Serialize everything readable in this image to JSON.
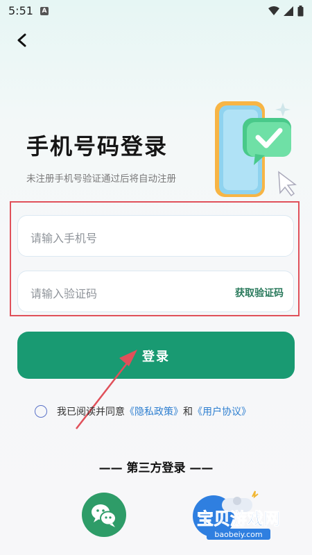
{
  "status_bar": {
    "time": "5:51",
    "app_icon": "A"
  },
  "header": {
    "back_icon": "back-chevron-icon"
  },
  "title": "手机号码登录",
  "subtitle": "未注册手机号验证通过后将自动注册",
  "phone_input": {
    "placeholder": "请输入手机号"
  },
  "code_input": {
    "placeholder": "请输入验证码",
    "get_code_label": "获取验证码"
  },
  "login_button": {
    "label": "登录"
  },
  "agreement": {
    "prefix": "我已阅读并同意",
    "privacy": "《隐私政策》",
    "and": "和",
    "user": "《用户协议》"
  },
  "third_party": {
    "title": "—— 第三方登录 ——",
    "options": [
      "wechat-icon"
    ]
  },
  "watermark": {
    "text": "宝贝游戏网",
    "url": "baobeiy.com"
  },
  "colors": {
    "primary": "#199a72",
    "link": "#2e7fd0",
    "highlight": "#e0505a"
  }
}
